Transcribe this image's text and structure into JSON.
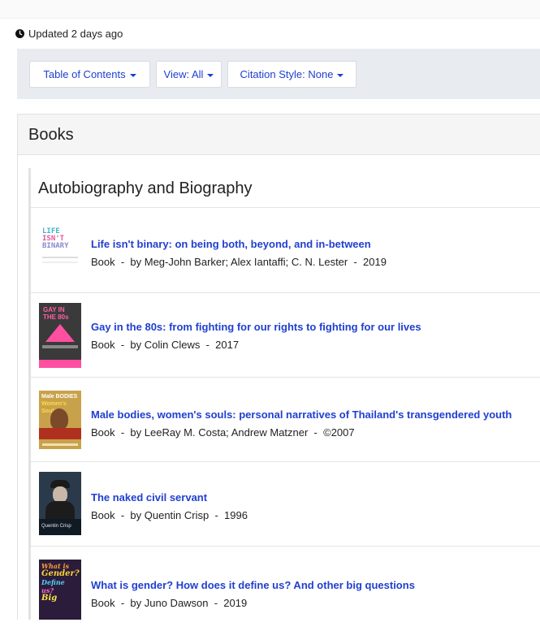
{
  "updated": {
    "text": "Updated 2 days ago"
  },
  "toolbar": {
    "toc_label": "Table of Contents",
    "view_label": "View: All",
    "citation_label": "Citation Style: None"
  },
  "panel": {
    "title": "Books"
  },
  "section": {
    "title": "Autobiography and Biography",
    "items": [
      {
        "title": "Life isn't binary: on being both, beyond, and in-between",
        "meta": "Book  -  by Meg-John Barker; Alex Iantaffi; C. N. Lester  -  2019",
        "cover_text": [
          "LIFE",
          "ISN'T",
          "BINARY"
        ]
      },
      {
        "title": "Gay in the 80s: from fighting for our rights to fighting for our lives",
        "meta": "Book  -  by Colin Clews  -  2017",
        "cover_text": [
          "GAY IN",
          "THE 80s"
        ]
      },
      {
        "title": "Male bodies, women's souls: personal narratives of Thailand's transgendered youth",
        "meta": "Book  -  by LeeRay M. Costa; Andrew Matzner  -  ©2007",
        "cover_text": [
          "Male BODIES",
          "Women's Souls"
        ]
      },
      {
        "title": "The naked civil servant",
        "meta": "Book  -  by Quentin Crisp  -  1996",
        "cover_text": [
          "Quentin Crisp"
        ]
      },
      {
        "title": "What is gender? How does it define us? And other big questions",
        "meta": "Book  -  by Juno Dawson  -  2019",
        "cover_text": [
          "What is",
          "Gender?",
          "Define",
          "us?",
          "Big"
        ]
      }
    ]
  },
  "colors": {
    "link": "#1f3fd0",
    "toolbar_bg": "#e8ecf1",
    "panel_header_bg": "#f5f5f5",
    "border": "#e2e2e2"
  },
  "icons": {
    "updated": "clock-icon",
    "dropdown": "caret-down-icon"
  }
}
